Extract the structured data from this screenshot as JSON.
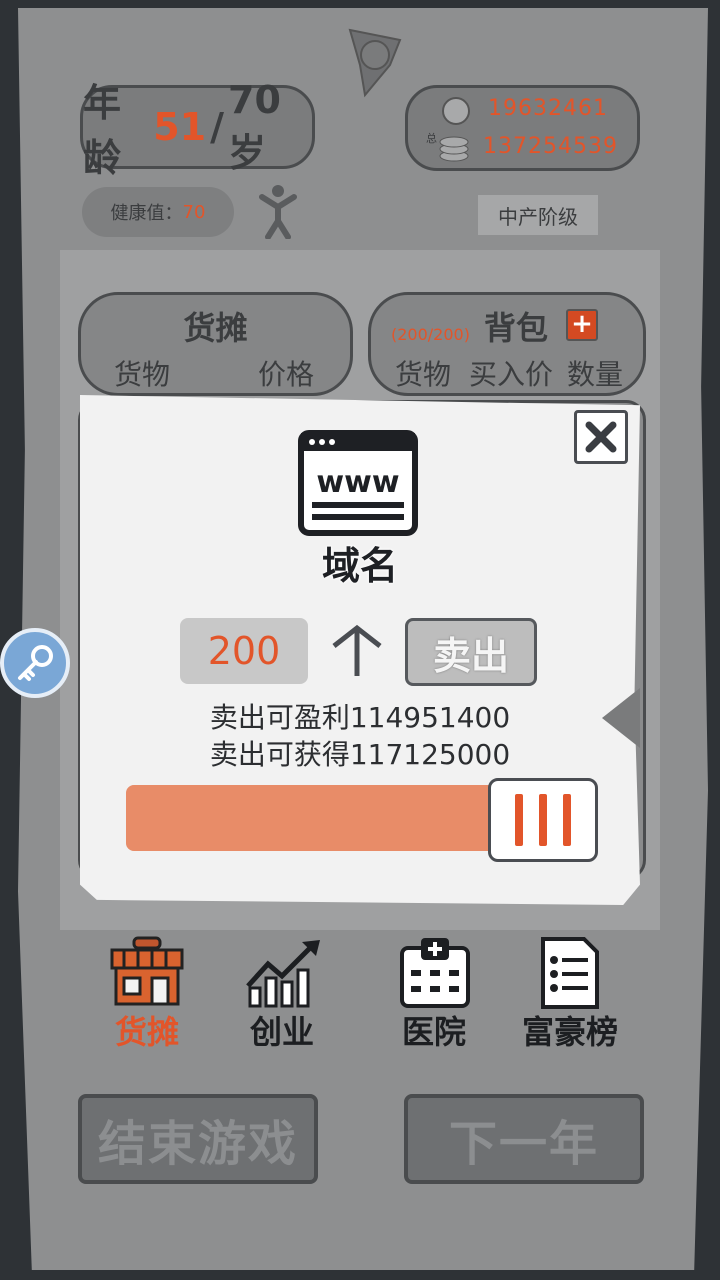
{
  "header": {
    "age_prefix": "年龄",
    "age_current": "51",
    "age_separator": "/",
    "age_max": "70岁",
    "cash": "19632461",
    "total_label": "总",
    "total": "137254539",
    "health_label": "健康值：",
    "health_value": "70",
    "class_label": "中产阶级"
  },
  "stall_panel": {
    "title": "货摊",
    "col_goods": "货物",
    "col_price": "价格"
  },
  "bag_panel": {
    "capacity": "(200/200)",
    "title": "背包",
    "col_goods": "货物",
    "col_buy_price": "买入价",
    "col_quantity": "数量"
  },
  "popup": {
    "item_icon": "www-browser-icon",
    "item_name": "域名",
    "quantity": "200",
    "sell_label": "卖出",
    "profit_text": "卖出可盈利114951400",
    "gain_text": "卖出可获得117125000",
    "slider_fraction": 1.0
  },
  "nav": {
    "items": [
      {
        "label": "货摊",
        "icon": "shop-icon",
        "active": true
      },
      {
        "label": "创业",
        "icon": "chart-growth-icon",
        "active": false
      },
      {
        "label": "医院",
        "icon": "hospital-icon",
        "active": false
      },
      {
        "label": "富豪榜",
        "icon": "ranking-list-icon",
        "active": false
      }
    ]
  },
  "footer": {
    "end_game": "结束游戏",
    "next_year": "下一年"
  },
  "colors": {
    "accent": "#e2552a",
    "slider_fill": "#e88c68",
    "paper": "#8e8f90",
    "popup_bg": "#f2f2f2"
  }
}
